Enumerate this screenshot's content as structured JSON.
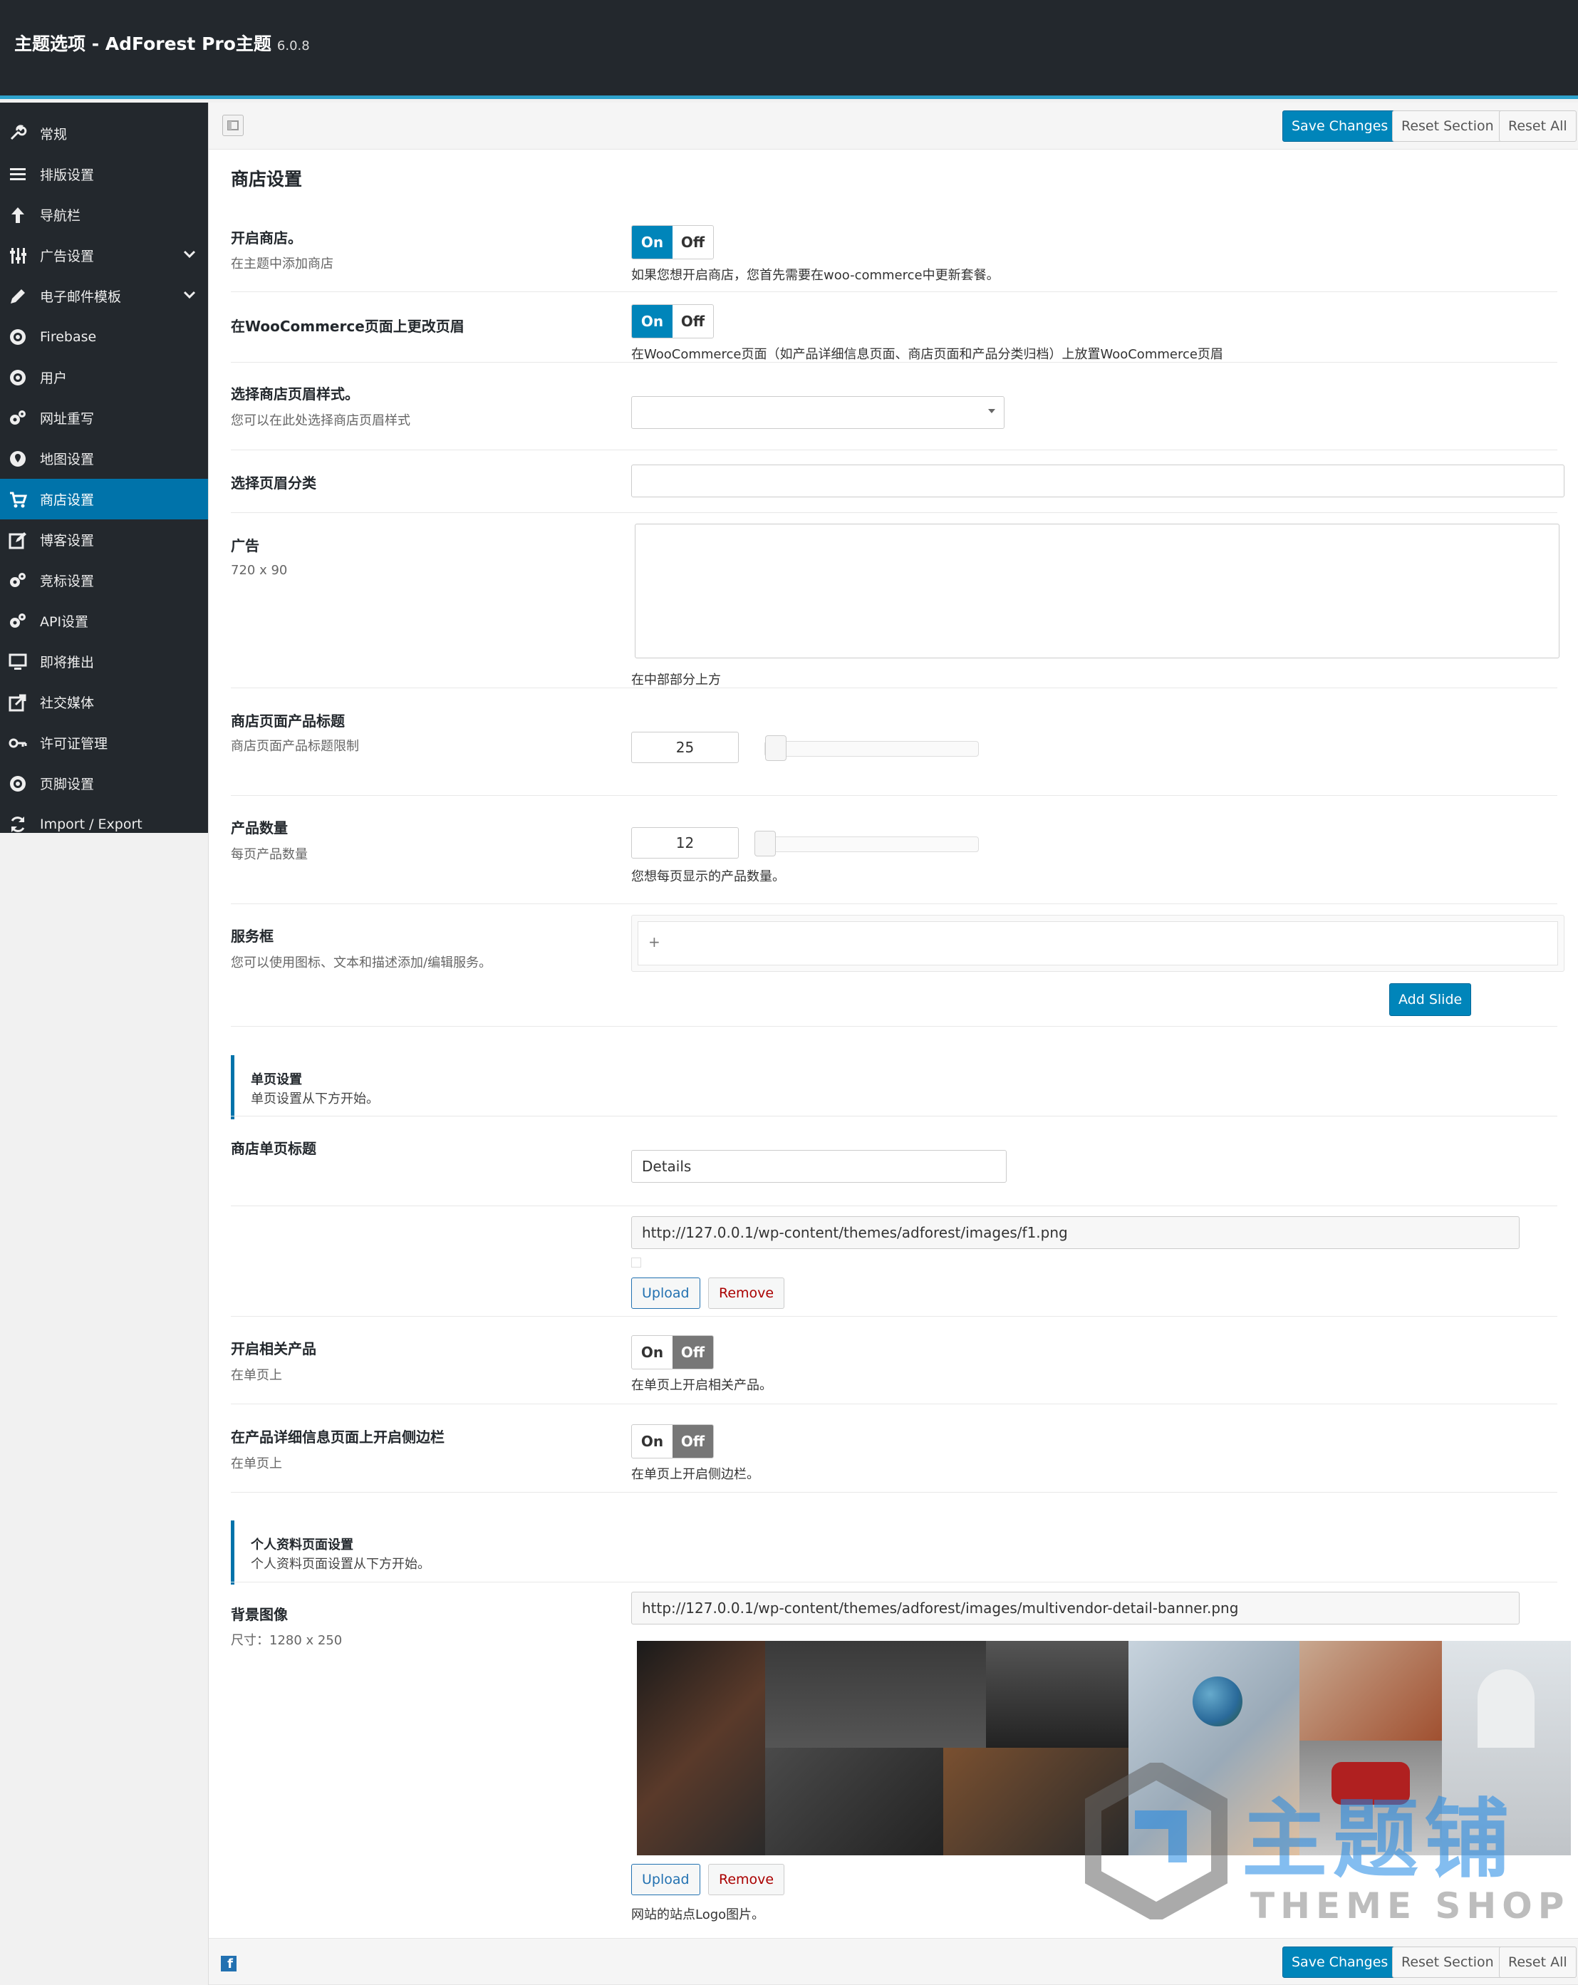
{
  "header": {
    "title": "主题选项 - AdForest Pro主题",
    "version": "6.0.8"
  },
  "sidebar": {
    "items": [
      {
        "label": "常规",
        "icon": "wrench-icon"
      },
      {
        "label": "排版设置",
        "icon": "list-icon"
      },
      {
        "label": "导航栏",
        "icon": "arrow-up-icon"
      },
      {
        "label": "广告设置",
        "icon": "sliders-icon"
      },
      {
        "label": "电子邮件模板",
        "icon": "pencil-icon"
      },
      {
        "label": "Firebase",
        "icon": "cog-circle-icon"
      },
      {
        "label": "用户",
        "icon": "cog-circle-icon"
      },
      {
        "label": "网址重写",
        "icon": "cogs-icon"
      },
      {
        "label": "地图设置",
        "icon": "map-pin-icon"
      },
      {
        "label": "商店设置",
        "icon": "cart-icon"
      },
      {
        "label": "博客设置",
        "icon": "edit-icon"
      },
      {
        "label": "竞标设置",
        "icon": "cogs-icon"
      },
      {
        "label": "API设置",
        "icon": "cogs-icon"
      },
      {
        "label": "即将推出",
        "icon": "monitor-icon"
      },
      {
        "label": "社交媒体",
        "icon": "share-icon"
      },
      {
        "label": "许可证管理",
        "icon": "key-icon"
      },
      {
        "label": "页脚设置",
        "icon": "cog-circle-icon"
      },
      {
        "label": "Import / Export",
        "icon": "refresh-icon"
      }
    ],
    "active_index": 9
  },
  "toolbar": {
    "save": "Save Changes",
    "reset_section": "Reset Section",
    "reset_all": "Reset All"
  },
  "section_title": "商店设置",
  "toggle": {
    "on": "On",
    "off": "Off"
  },
  "fields": {
    "open_shop": {
      "label": "开启商店。",
      "sub": "在主题中添加商店",
      "desc": "如果您想开启商店，您首先需要在woo-commerce中更新套餐。",
      "value": "On"
    },
    "woo_header": {
      "label": "在WooCommerce页面上更改页眉",
      "desc": "在WooCommerce页面（如产品详细信息页面、商店页面和产品分类归档）上放置WooCommerce页眉",
      "value": "On"
    },
    "header_style": {
      "label": "选择商店页眉样式。",
      "sub": "您可以在此处选择商店页眉样式",
      "value": ""
    },
    "header_category": {
      "label": "选择页眉分类",
      "value": ""
    },
    "ad": {
      "label": "广告",
      "sub": "720 x 90",
      "desc": "在中部部分上方",
      "value": ""
    },
    "title_limit": {
      "label": "商店页面产品标题",
      "sub": "商店页面产品标题限制",
      "value": "25"
    },
    "product_count": {
      "label": "产品数量",
      "sub": "每页产品数量",
      "desc": "您想每页显示的产品数量。",
      "value": "12"
    },
    "service_box": {
      "label": "服务框",
      "sub": "您可以使用图标、文本和描述添加/编辑服务。",
      "plus": "+",
      "add_slide": "Add Slide"
    },
    "single_info": {
      "title": "单页设置",
      "sub": "单页设置从下方开始。"
    },
    "single_title": {
      "label": "商店单页标题",
      "value": "Details"
    },
    "single_image": {
      "url": "http://127.0.0.1/wp-content/themes/adforest/images/f1.png",
      "upload": "Upload",
      "remove": "Remove"
    },
    "related": {
      "label": "开启相关产品",
      "sub": "在单页上",
      "desc": "在单页上开启相关产品。",
      "value": "Off"
    },
    "sidebar_toggle": {
      "label": "在产品详细信息页面上开启侧边栏",
      "sub": "在单页上",
      "desc": "在单页上开启侧边栏。",
      "value": "Off"
    },
    "profile_info": {
      "title": "个人资料页面设置",
      "sub": "个人资料页面设置从下方开始。"
    },
    "bg_image": {
      "label": "背景图像",
      "sub": "尺寸：1280 x 250",
      "url": "http://127.0.0.1/wp-content/themes/adforest/images/multivendor-detail-banner.png",
      "upload": "Upload",
      "remove": "Remove",
      "desc": "网站的站点Logo图片。"
    }
  },
  "watermark": {
    "text": "主题铺",
    "sub": "THEME SHOP"
  },
  "colors": {
    "accent": "#0085ba",
    "sidebar": "#23282d",
    "topbar_border": "#2ea2cc"
  }
}
